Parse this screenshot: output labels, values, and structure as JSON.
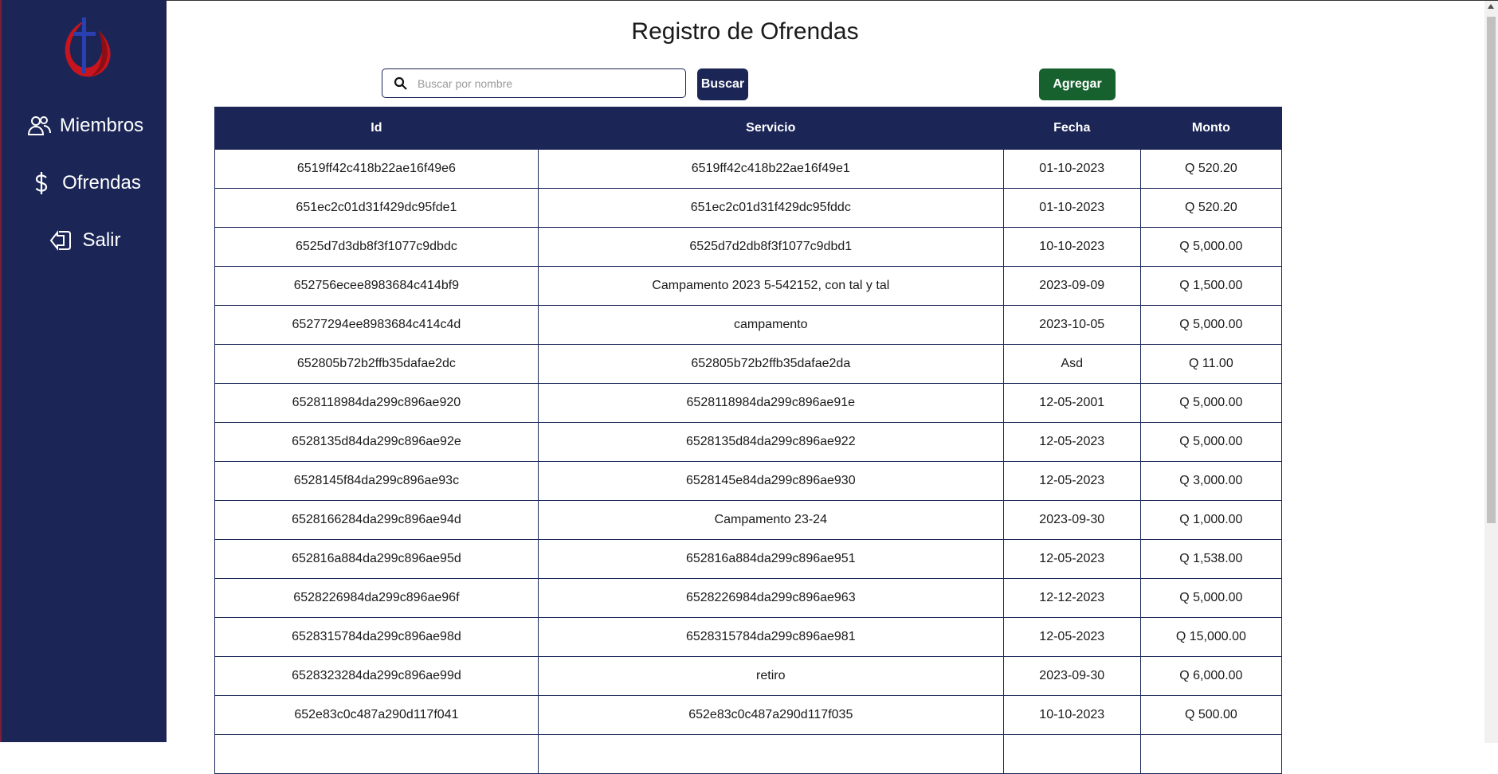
{
  "sidebar": {
    "items": [
      {
        "label": "Miembros",
        "icon": "users-icon"
      },
      {
        "label": "Ofrendas",
        "icon": "dollar-icon"
      },
      {
        "label": "Salir",
        "icon": "logout-icon"
      }
    ]
  },
  "page": {
    "title": "Registro de Ofrendas"
  },
  "search": {
    "placeholder": "Buscar por nombre",
    "value": "",
    "button_label": "Buscar"
  },
  "actions": {
    "add_label": "Agregar"
  },
  "table": {
    "headers": [
      "Id",
      "Servicio",
      "Fecha",
      "Monto"
    ],
    "rows": [
      [
        "6519ff42c418b22ae16f49e6",
        "6519ff42c418b22ae16f49e1",
        "01-10-2023",
        "Q 520.20"
      ],
      [
        "651ec2c01d31f429dc95fde1",
        "651ec2c01d31f429dc95fddc",
        "01-10-2023",
        "Q 520.20"
      ],
      [
        "6525d7d3db8f3f1077c9dbdc",
        "6525d7d2db8f3f1077c9dbd1",
        "10-10-2023",
        "Q 5,000.00"
      ],
      [
        "652756ecee8983684c414bf9",
        "Campamento 2023 5-542152, con tal y tal",
        "2023-09-09",
        "Q 1,500.00"
      ],
      [
        "65277294ee8983684c414c4d",
        "campamento",
        "2023-10-05",
        "Q 5,000.00"
      ],
      [
        "652805b72b2ffb35dafae2dc",
        "652805b72b2ffb35dafae2da",
        "Asd",
        "Q 11.00"
      ],
      [
        "6528118984da299c896ae920",
        "6528118984da299c896ae91e",
        "12-05-2001",
        "Q 5,000.00"
      ],
      [
        "6528135d84da299c896ae92e",
        "6528135d84da299c896ae922",
        "12-05-2023",
        "Q 5,000.00"
      ],
      [
        "6528145f84da299c896ae93c",
        "6528145e84da299c896ae930",
        "12-05-2023",
        "Q 3,000.00"
      ],
      [
        "6528166284da299c896ae94d",
        "Campamento 23-24",
        "2023-09-30",
        "Q 1,000.00"
      ],
      [
        "652816a884da299c896ae95d",
        "652816a884da299c896ae951",
        "12-05-2023",
        "Q 1,538.00"
      ],
      [
        "6528226984da299c896ae96f",
        "6528226984da299c896ae963",
        "12-12-2023",
        "Q 5,000.00"
      ],
      [
        "6528315784da299c896ae98d",
        "6528315784da299c896ae981",
        "12-05-2023",
        "Q 15,000.00"
      ],
      [
        "6528323284da299c896ae99d",
        "retiro",
        "2023-09-30",
        "Q 6,000.00"
      ],
      [
        "652e83c0c487a290d117f041",
        "652e83c0c487a290d117f035",
        "10-10-2023",
        "Q 500.00"
      ],
      [
        "",
        "",
        "",
        ""
      ]
    ]
  }
}
